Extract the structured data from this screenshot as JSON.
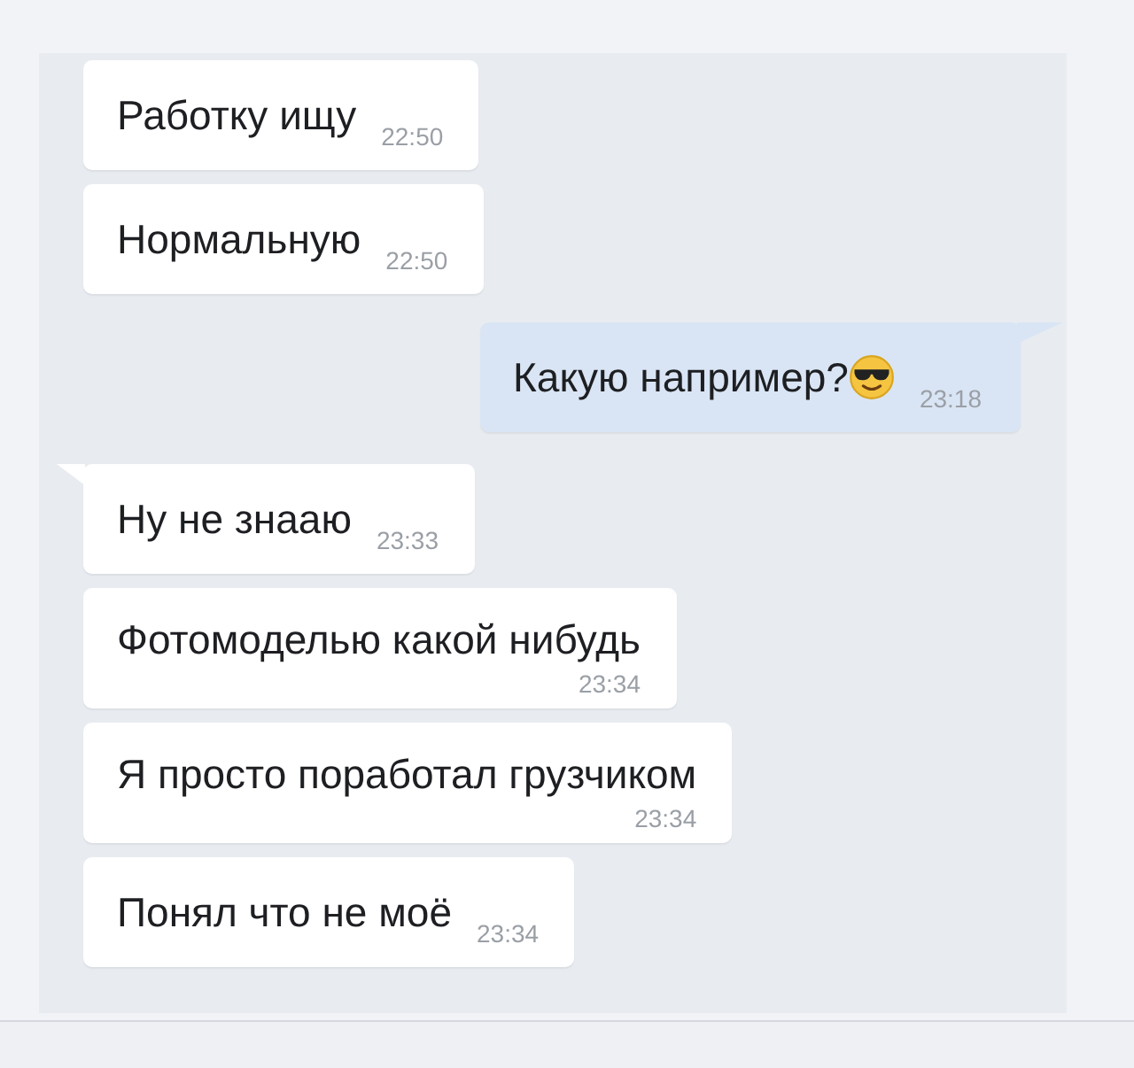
{
  "messages": [
    {
      "text": "Работку ищу",
      "time": "22:50",
      "outgoing": false,
      "tail": false,
      "kind": "inline",
      "emoji": false
    },
    {
      "text": "Нормальную",
      "time": "22:50",
      "outgoing": false,
      "tail": false,
      "kind": "inline",
      "emoji": false
    },
    {
      "text": "Какую например?",
      "time": "23:18",
      "outgoing": true,
      "tail": true,
      "kind": "inline",
      "emoji": true
    },
    {
      "text": "Ну не знааю",
      "time": "23:33",
      "outgoing": false,
      "tail": true,
      "kind": "inline",
      "emoji": false
    },
    {
      "text": "Фотомоделью какой нибудь",
      "time": "23:34",
      "outgoing": false,
      "tail": false,
      "kind": "stacked",
      "emoji": false
    },
    {
      "text": "Я просто поработал грузчиком",
      "time": "23:34",
      "outgoing": false,
      "tail": false,
      "kind": "stacked",
      "emoji": false
    },
    {
      "text": "Понял что не моё",
      "time": "23:34",
      "outgoing": false,
      "tail": false,
      "kind": "inline",
      "emoji": false
    }
  ]
}
